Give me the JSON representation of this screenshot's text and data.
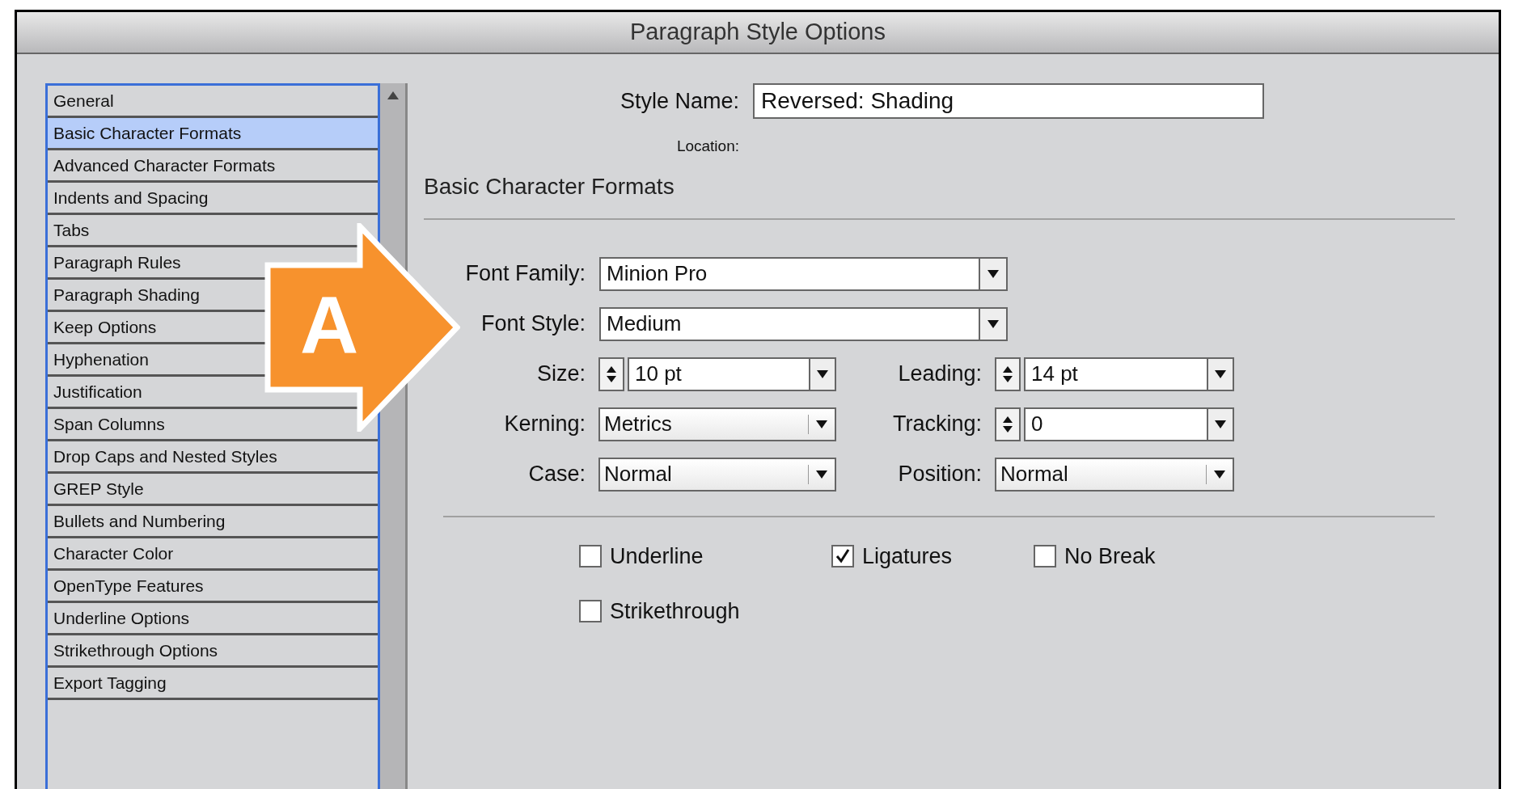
{
  "window": {
    "title": "Paragraph Style Options"
  },
  "sidebar": {
    "items": [
      {
        "label": "General",
        "selected": false
      },
      {
        "label": "Basic Character Formats",
        "selected": true
      },
      {
        "label": "Advanced Character Formats",
        "selected": false
      },
      {
        "label": "Indents and Spacing",
        "selected": false
      },
      {
        "label": "Tabs",
        "selected": false
      },
      {
        "label": "Paragraph Rules",
        "selected": false
      },
      {
        "label": "Paragraph Shading",
        "selected": false
      },
      {
        "label": "Keep Options",
        "selected": false
      },
      {
        "label": "Hyphenation",
        "selected": false
      },
      {
        "label": "Justification",
        "selected": false
      },
      {
        "label": "Span Columns",
        "selected": false
      },
      {
        "label": "Drop Caps and Nested Styles",
        "selected": false
      },
      {
        "label": "GREP Style",
        "selected": false
      },
      {
        "label": "Bullets and Numbering",
        "selected": false
      },
      {
        "label": "Character Color",
        "selected": false
      },
      {
        "label": "OpenType Features",
        "selected": false
      },
      {
        "label": "Underline Options",
        "selected": false
      },
      {
        "label": "Strikethrough Options",
        "selected": false
      },
      {
        "label": "Export Tagging",
        "selected": false
      }
    ]
  },
  "style_name": {
    "label": "Style Name:",
    "value": "Reversed: Shading"
  },
  "location": {
    "label": "Location:"
  },
  "section_title": "Basic Character Formats",
  "wide_fields": [
    {
      "label": "Font Family:",
      "value": "Minion Pro",
      "kind": "combo"
    },
    {
      "label": "Font Style:",
      "value": "Medium",
      "kind": "combo"
    }
  ],
  "grid_rows": [
    [
      {
        "label": "Size:",
        "value": "10 pt",
        "kind": "spin-combo"
      },
      {
        "label": "Leading:",
        "value": "14 pt",
        "kind": "spin-combo"
      }
    ],
    [
      {
        "label": "Kerning:",
        "value": "Metrics",
        "kind": "popup"
      },
      {
        "label": "Tracking:",
        "value": "0",
        "kind": "spin-combo"
      }
    ],
    [
      {
        "label": "Case:",
        "value": "Normal",
        "kind": "popup"
      },
      {
        "label": "Position:",
        "value": "Normal",
        "kind": "popup"
      }
    ]
  ],
  "checkboxes": [
    {
      "label": "Underline",
      "checked": false
    },
    {
      "label": "Ligatures",
      "checked": true
    },
    {
      "label": "No Break",
      "checked": false
    },
    {
      "label": "Strikethrough",
      "checked": false
    }
  ],
  "callout": {
    "label": "A"
  }
}
